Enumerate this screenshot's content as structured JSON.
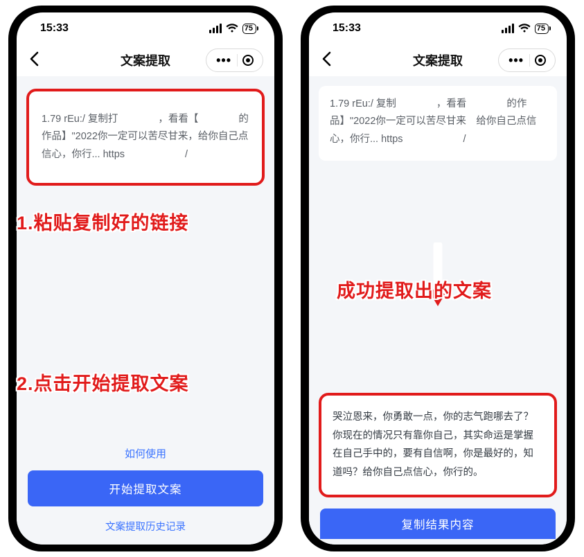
{
  "status": {
    "time": "15:33",
    "battery": "75"
  },
  "nav": {
    "title": "文案提取"
  },
  "left": {
    "input_text": "1.79 rEu:/ 复制打    ，看看【    的作品】\"2022你一定可以苦尽甘来，给你自己点信心，你行... https      /",
    "how_to": "如何使用",
    "start_btn": "开始提取文案",
    "history": "文案提取历史记录"
  },
  "right": {
    "input_text": "1.79 rEu:/ 复制    ，看看    的作品】\"2022你一定可以苦尽甘来 给你自己点信心，你行... https      /",
    "result_text": "哭泣恩来，你勇敢一点，你的志气跑哪去了？你现在的情况只有靠你自己，其实命运是掌握在自己手中的，要有自信啊，你是最好的，知道吗？给你自己点信心，你行的。",
    "copy_btn": "复制结果内容"
  },
  "annotations": {
    "a1": "1.粘贴复制好的链接",
    "a2": "2.点击开始提取文案",
    "a3": "成功提取出的文案"
  }
}
